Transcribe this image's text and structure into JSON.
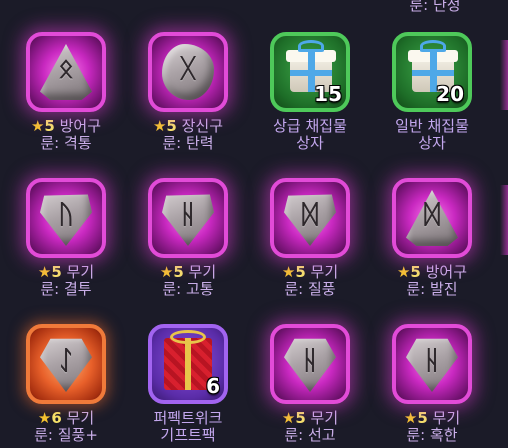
{
  "top_partial_label": "룬: 단정",
  "items": [
    {
      "id": "r1c1",
      "kind": "rune",
      "rarity": "pink",
      "shape": "tri",
      "glyph": "ᛟ",
      "star_text": "★",
      "grade": "5",
      "type": "방어구",
      "name": "룬: 격통"
    },
    {
      "id": "r1c2",
      "kind": "rune",
      "rarity": "pink",
      "shape": "round",
      "glyph": "ᚷ",
      "star_text": "★",
      "grade": "5",
      "type": "장신구",
      "name": "룬: 탄력"
    },
    {
      "id": "r1c3",
      "kind": "box",
      "rarity": "green",
      "count": "15",
      "line1": "상급 채집물",
      "line2": "상자"
    },
    {
      "id": "r1c4",
      "kind": "box",
      "rarity": "green",
      "count": "20",
      "line1": "일반 채집물",
      "line2": "상자"
    },
    {
      "id": "r2c1",
      "kind": "rune",
      "rarity": "pink",
      "shape": "shield",
      "glyph": "ᚢ",
      "star_text": "★",
      "grade": "5",
      "type": "무기",
      "name": "룬: 결투"
    },
    {
      "id": "r2c2",
      "kind": "rune",
      "rarity": "pink",
      "shape": "shield",
      "glyph": "ᚺ",
      "star_text": "★",
      "grade": "5",
      "type": "무기",
      "name": "룬: 고통"
    },
    {
      "id": "r2c3",
      "kind": "rune",
      "rarity": "pink",
      "shape": "shield",
      "glyph": "ᛞ",
      "star_text": "★",
      "grade": "5",
      "type": "무기",
      "name": "룬: 질풍"
    },
    {
      "id": "r2c4",
      "kind": "rune",
      "rarity": "pink",
      "shape": "tri",
      "glyph": "ᛞ",
      "star_text": "★",
      "grade": "5",
      "type": "방어구",
      "name": "룬: 발진"
    },
    {
      "id": "r3c1",
      "kind": "rune",
      "rarity": "orange",
      "shape": "gem",
      "glyph": "ᛇ",
      "star_text": "★",
      "grade": "6",
      "type": "무기",
      "name": "룬: 질풍+"
    },
    {
      "id": "r3c2",
      "kind": "bag",
      "rarity": "purple",
      "count": "6",
      "line1": "퍼펙트위크",
      "line2": "기프트팩"
    },
    {
      "id": "r3c3",
      "kind": "rune",
      "rarity": "pink",
      "shape": "gem",
      "glyph": "ᚺ",
      "star_text": "★",
      "grade": "5",
      "type": "무기",
      "name": "룬: 선고"
    },
    {
      "id": "r3c4",
      "kind": "rune",
      "rarity": "pink",
      "shape": "gem",
      "glyph": "ᚺ",
      "star_text": "★",
      "grade": "5",
      "type": "무기",
      "name": "룬: 혹한"
    }
  ],
  "colors": {
    "rune_text": "#c9aee8",
    "star": "#f4c430",
    "grade": "#f6e36a",
    "pink_border": "#e24bd8",
    "orange_border": "#f07a3a",
    "green_border": "#4ec95a",
    "purple_border": "#a264f0"
  }
}
